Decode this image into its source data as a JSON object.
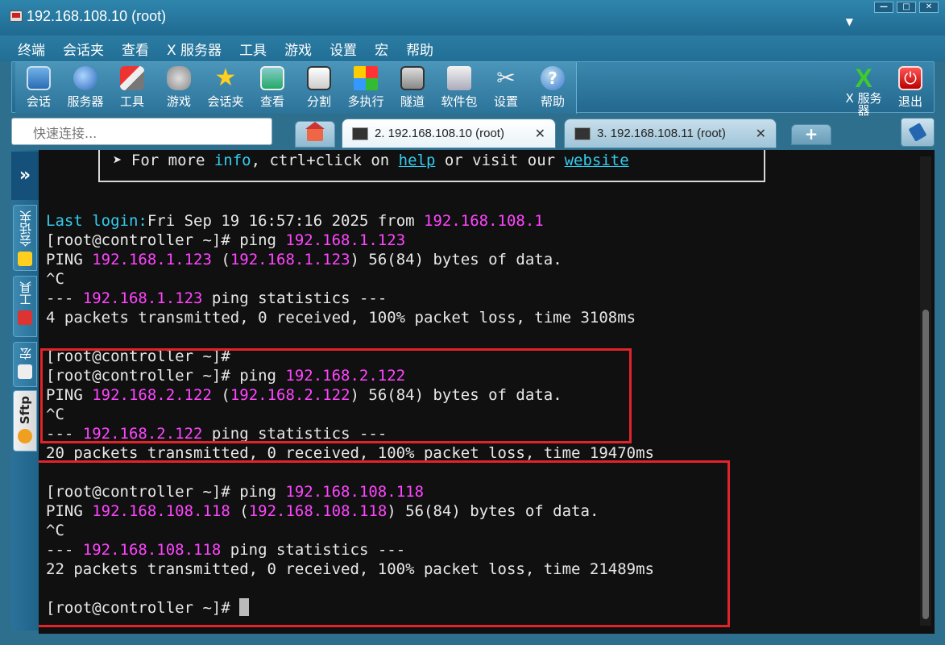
{
  "window": {
    "title": "192.168.108.10 (root)"
  },
  "menubar": [
    "终端",
    "会话夹",
    "查看",
    "X 服务器",
    "工具",
    "游戏",
    "设置",
    "宏",
    "帮助"
  ],
  "toolbar": {
    "items": [
      {
        "label": "会话",
        "icon": "session-icon"
      },
      {
        "label": "服务器",
        "icon": "server-icon"
      },
      {
        "label": "工具",
        "icon": "tools-icon"
      },
      {
        "label": "游戏",
        "icon": "games-icon"
      },
      {
        "label": "会话夹",
        "icon": "star-icon"
      },
      {
        "label": "查看",
        "icon": "view-icon"
      },
      {
        "label": "分割",
        "icon": "split-icon"
      },
      {
        "label": "多执行",
        "icon": "multiexec-icon"
      },
      {
        "label": "隧道",
        "icon": "tunnel-icon"
      },
      {
        "label": "软件包",
        "icon": "packages-icon"
      },
      {
        "label": "设置",
        "icon": "settings-icon"
      },
      {
        "label": "帮助",
        "icon": "help-icon"
      }
    ],
    "xserver_label_1": "X 服务",
    "xserver_label_2": "器",
    "exit_label": "退出"
  },
  "quick_connect": {
    "placeholder": "快速连接..."
  },
  "tabs": [
    {
      "label": "2. 192.168.108.10 (root)",
      "active": true
    },
    {
      "label": "3. 192.168.108.11 (root)",
      "active": false
    }
  ],
  "side_tabs": [
    "会话夹",
    "工具",
    "宏",
    "Sftp"
  ],
  "terminal": {
    "banner": {
      "prefix": "➤ For more ",
      "info": "info",
      "mid": ", ctrl+click on ",
      "help": "help",
      "mid2": " or visit our ",
      "website": "website"
    },
    "lines": [
      {
        "parts": [
          [
            "cyan",
            "Last login:"
          ],
          [
            "",
            "Fri Sep 19 16:57:16 2025 from "
          ],
          [
            "mag",
            "192.168.108.1"
          ]
        ]
      },
      {
        "parts": [
          [
            "",
            "[root@controller ~]# ping "
          ],
          [
            "mag",
            "192.168.1.123"
          ]
        ]
      },
      {
        "parts": [
          [
            "",
            "PING "
          ],
          [
            "mag",
            "192.168.1.123"
          ],
          [
            "",
            " ("
          ],
          [
            "mag",
            "192.168.1.123"
          ],
          [
            "",
            ") 56(84) bytes of data."
          ]
        ]
      },
      {
        "parts": [
          [
            "",
            "^C"
          ]
        ]
      },
      {
        "parts": [
          [
            "",
            "--- "
          ],
          [
            "mag",
            "192.168.1.123"
          ],
          [
            "",
            " ping statistics ---"
          ]
        ]
      },
      {
        "parts": [
          [
            "",
            "4 packets transmitted, 0 received, 100% packet loss, time 3108ms"
          ]
        ]
      },
      {
        "parts": [
          [
            "",
            ""
          ]
        ]
      },
      {
        "parts": [
          [
            "",
            "[root@controller ~]#"
          ]
        ]
      },
      {
        "parts": [
          [
            "",
            "[root@controller ~]# ping "
          ],
          [
            "mag",
            "192.168.2.122"
          ]
        ]
      },
      {
        "parts": [
          [
            "",
            "PING "
          ],
          [
            "mag",
            "192.168.2.122"
          ],
          [
            "",
            " ("
          ],
          [
            "mag",
            "192.168.2.122"
          ],
          [
            "",
            ") 56(84) bytes of data."
          ]
        ]
      },
      {
        "parts": [
          [
            "",
            "^C"
          ]
        ]
      },
      {
        "parts": [
          [
            "",
            "--- "
          ],
          [
            "mag",
            "192.168.2.122"
          ],
          [
            "",
            " ping statistics ---"
          ]
        ]
      },
      {
        "parts": [
          [
            "",
            "20 packets transmitted, 0 received, 100% packet loss, time 19470ms"
          ]
        ]
      },
      {
        "parts": [
          [
            "",
            ""
          ]
        ]
      },
      {
        "parts": [
          [
            "",
            "[root@controller ~]# ping "
          ],
          [
            "mag",
            "192.168.108.118"
          ]
        ]
      },
      {
        "parts": [
          [
            "",
            "PING "
          ],
          [
            "mag",
            "192.168.108.118"
          ],
          [
            "",
            " ("
          ],
          [
            "mag",
            "192.168.108.118"
          ],
          [
            "",
            ") 56(84) bytes of data."
          ]
        ]
      },
      {
        "parts": [
          [
            "",
            "^C"
          ]
        ]
      },
      {
        "parts": [
          [
            "",
            "--- "
          ],
          [
            "mag",
            "192.168.108.118"
          ],
          [
            "",
            " ping statistics ---"
          ]
        ]
      },
      {
        "parts": [
          [
            "",
            "22 packets transmitted, 0 received, 100% packet loss, time 21489ms"
          ]
        ]
      },
      {
        "parts": [
          [
            "",
            ""
          ]
        ]
      },
      {
        "parts": [
          [
            "",
            "[root@controller ~]# "
          ]
        ],
        "cursor": true
      }
    ]
  },
  "colors": {
    "accent": "#2a7ba2",
    "magenta": "#ff44ff",
    "cyan": "#33ccee",
    "highlight": "#e0242a"
  }
}
